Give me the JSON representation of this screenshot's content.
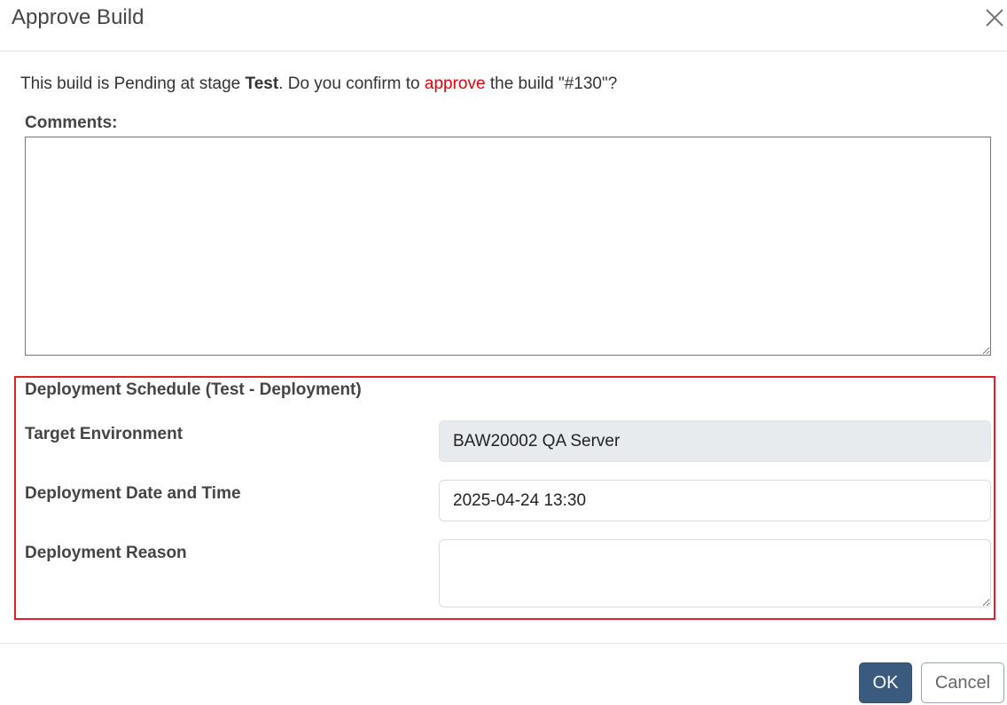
{
  "dialog": {
    "title": "Approve Build",
    "close_icon": "close-icon"
  },
  "message": {
    "prefix": "This build is Pending at stage ",
    "stage": "Test",
    "middle": ". Do you confirm to ",
    "action": "approve",
    "suffix": " the build \"#130\"?",
    "action_color": "#e3000b"
  },
  "comments": {
    "label": "Comments:",
    "value": ""
  },
  "schedule": {
    "title": "Deployment Schedule (Test - Deployment)",
    "highlight_color": "#e0202a",
    "target_environment": {
      "label": "Target Environment",
      "value": "BAW20002 QA Server"
    },
    "deployment_datetime": {
      "label": "Deployment Date and Time",
      "value": "2025-04-24 13:30"
    },
    "deployment_reason": {
      "label": "Deployment Reason",
      "value": ""
    }
  },
  "footer": {
    "ok_label": "OK",
    "cancel_label": "Cancel",
    "ok_color": "#3a5b7e"
  }
}
